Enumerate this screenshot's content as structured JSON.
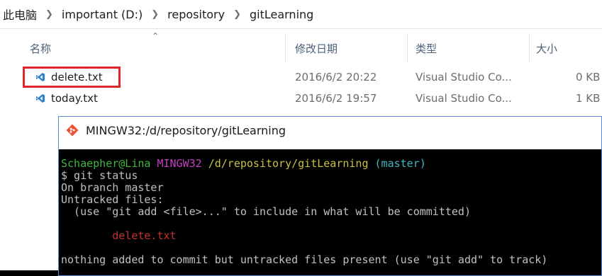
{
  "explorer": {
    "breadcrumbs": [
      "此电脑",
      "important (D:)",
      "repository",
      "gitLearning"
    ],
    "columns": {
      "name": "名称",
      "date": "修改日期",
      "type": "类型",
      "size": "大小"
    },
    "files": [
      {
        "name": "delete.txt",
        "modified": "2016/6/2 20:22",
        "type": "Visual Studio Co...",
        "size": "0 KB",
        "icon": "vscode-file-icon",
        "highlighted": true
      },
      {
        "name": "today.txt",
        "modified": "2016/6/2 19:57",
        "type": "Visual Studio Co...",
        "size": "1 KB",
        "icon": "vscode-file-icon",
        "highlighted": false
      }
    ],
    "highlight_color": "#e0262a"
  },
  "terminal": {
    "title": "MINGW32:/d/repository/gitLearning",
    "prompt": {
      "user_host": "Schaepher@Lina",
      "system": "MINGW32",
      "path": "/d/repository/gitLearning",
      "branch": "(master)"
    },
    "command": "$ git status",
    "output": {
      "line1": "On branch master",
      "line2": "Untracked files:",
      "line3": "  (use \"git add <file>...\" to include in what will be committed)",
      "untracked_file": "delete.txt",
      "summary": "nothing added to commit but untracked files present (use \"git add\" to track)"
    },
    "colors": {
      "background": "#000000",
      "user_host": "#3fb740",
      "system": "#c23fc2",
      "path": "#c8c23f",
      "branch": "#3fb7c2",
      "untracked": "#c83030",
      "text": "#c0c0c0"
    }
  }
}
